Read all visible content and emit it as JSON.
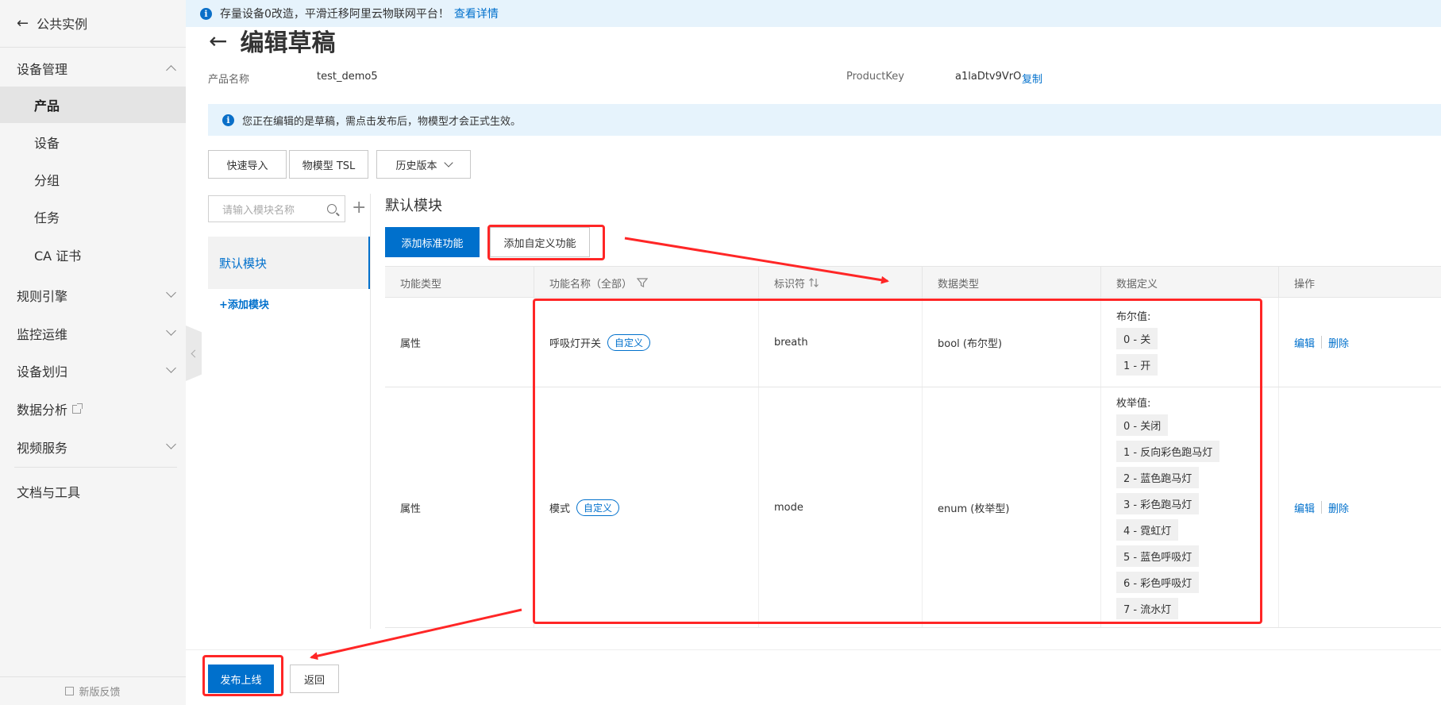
{
  "sidebar": {
    "back_label": "公共实例",
    "device_mgmt": "设备管理",
    "items": [
      "产品",
      "设备",
      "分组",
      "任务",
      "CA 证书"
    ],
    "groups": [
      "规则引擎",
      "监控运维",
      "设备划归"
    ],
    "data_analysis": "数据分析",
    "video": "视频服务",
    "docs": "文档与工具",
    "feedback": "新版反馈"
  },
  "topbar": {
    "text": "存量设备0改造，平滑迁移阿里云物联网平台！",
    "link": "查看详情"
  },
  "page": {
    "title": "编辑草稿",
    "product_name_label": "产品名称",
    "product_name": "test_demo5",
    "product_key_label": "ProductKey",
    "product_key": "a1laDtv9VrO",
    "copy": "复制",
    "notice": "您正在编辑的是草稿，需点击发布后，物模型才会正式生效。"
  },
  "toolbar": {
    "quick_import": "快速导入",
    "tsl": "物模型 TSL",
    "history": "历史版本"
  },
  "modules": {
    "search_placeholder": "请输入模块名称",
    "default": "默认模块",
    "add": "+添加模块"
  },
  "main": {
    "module_title": "默认模块",
    "add_standard": "添加标准功能",
    "add_custom": "添加自定义功能"
  },
  "table": {
    "headers": [
      "功能类型",
      "功能名称（全部）",
      "标识符",
      "数据类型",
      "数据定义",
      "操作"
    ],
    "rows": [
      {
        "type": "属性",
        "name": "呼吸灯开关",
        "badge": "自定义",
        "identifier": "breath",
        "data_type": "bool (布尔型)",
        "def_label": "布尔值:",
        "defs": [
          "0 - 关",
          "1 - 开"
        ],
        "edit": "编辑",
        "delete": "删除"
      },
      {
        "type": "属性",
        "name": "模式",
        "badge": "自定义",
        "identifier": "mode",
        "data_type": "enum (枚举型)",
        "def_label": "枚举值:",
        "defs": [
          "0 - 关闭",
          "1 - 反向彩色跑马灯",
          "2 - 蓝色跑马灯",
          "3 - 彩色跑马灯",
          "4 - 霓虹灯",
          "5 - 蓝色呼吸灯",
          "6 - 彩色呼吸灯",
          "7 - 流水灯"
        ],
        "edit": "编辑",
        "delete": "删除"
      }
    ]
  },
  "footer": {
    "publish": "发布上线",
    "back": "返回"
  },
  "colors": {
    "accent": "#0070cc",
    "annotation": "#ff2626"
  }
}
